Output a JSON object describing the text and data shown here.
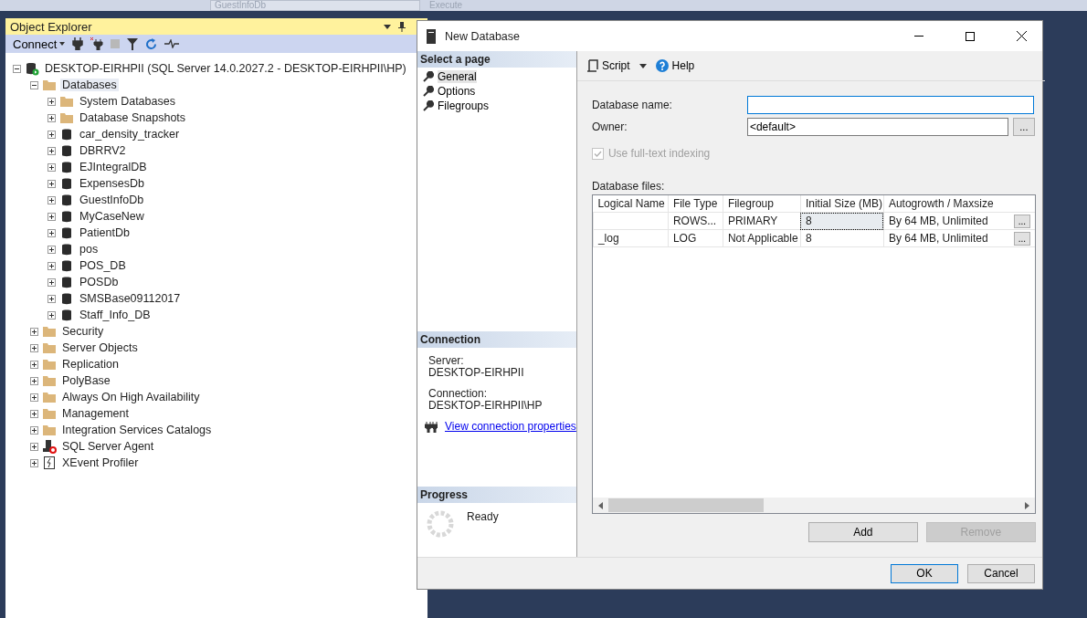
{
  "top_toolbar": {
    "database_combo": "GuestInfoDb",
    "execute": "Execute"
  },
  "object_explorer": {
    "title": "Object Explorer",
    "connect": "Connect",
    "tree": [
      {
        "label": "DESKTOP-EIRHPII (SQL Server 14.0.2027.2 - DESKTOP-EIRHPII\\HP)",
        "kind": "server",
        "expanded": true,
        "selected": false,
        "children": [
          {
            "label": "Databases",
            "kind": "folder",
            "expanded": true,
            "selected": true,
            "children": [
              {
                "label": "System Databases",
                "kind": "folder",
                "expanded": false,
                "selected": false
              },
              {
                "label": "Database Snapshots",
                "kind": "folder",
                "expanded": false,
                "selected": false
              },
              {
                "label": "car_density_tracker",
                "kind": "database",
                "expanded": false,
                "selected": false
              },
              {
                "label": "DBRRV2",
                "kind": "database",
                "expanded": false,
                "selected": false
              },
              {
                "label": "EJIntegralDB",
                "kind": "database",
                "expanded": false,
                "selected": false
              },
              {
                "label": "ExpensesDb",
                "kind": "database",
                "expanded": false,
                "selected": false
              },
              {
                "label": "GuestInfoDb",
                "kind": "database",
                "expanded": false,
                "selected": false
              },
              {
                "label": "MyCaseNew",
                "kind": "database",
                "expanded": false,
                "selected": false
              },
              {
                "label": "PatientDb",
                "kind": "database",
                "expanded": false,
                "selected": false
              },
              {
                "label": "pos",
                "kind": "database",
                "expanded": false,
                "selected": false
              },
              {
                "label": "POS_DB",
                "kind": "database",
                "expanded": false,
                "selected": false
              },
              {
                "label": "POSDb",
                "kind": "database",
                "expanded": false,
                "selected": false
              },
              {
                "label": "SMSBase09112017",
                "kind": "database",
                "expanded": false,
                "selected": false
              },
              {
                "label": "Staff_Info_DB",
                "kind": "database",
                "expanded": false,
                "selected": false
              }
            ]
          },
          {
            "label": "Security",
            "kind": "folder",
            "expanded": false,
            "selected": false
          },
          {
            "label": "Server Objects",
            "kind": "folder",
            "expanded": false,
            "selected": false
          },
          {
            "label": "Replication",
            "kind": "folder",
            "expanded": false,
            "selected": false
          },
          {
            "label": "PolyBase",
            "kind": "folder",
            "expanded": false,
            "selected": false
          },
          {
            "label": "Always On High Availability",
            "kind": "folder",
            "expanded": false,
            "selected": false
          },
          {
            "label": "Management",
            "kind": "folder",
            "expanded": false,
            "selected": false
          },
          {
            "label": "Integration Services Catalogs",
            "kind": "folder",
            "expanded": false,
            "selected": false
          },
          {
            "label": "SQL Server Agent",
            "kind": "agent",
            "expanded": false,
            "selected": false
          },
          {
            "label": "XEvent Profiler",
            "kind": "profiler",
            "expanded": false,
            "selected": false
          }
        ]
      }
    ]
  },
  "dialog": {
    "title": "New Database",
    "select_page": {
      "heading": "Select a page",
      "pages": [
        {
          "label": "General",
          "selected": true
        },
        {
          "label": "Options",
          "selected": false
        },
        {
          "label": "Filegroups",
          "selected": false
        }
      ]
    },
    "connection": {
      "heading": "Connection",
      "server_label": "Server:",
      "server": "DESKTOP-EIRHPII",
      "connection_label": "Connection:",
      "connection": "DESKTOP-EIRHPII\\HP",
      "link": "View connection properties"
    },
    "progress": {
      "heading": "Progress",
      "status": "Ready"
    },
    "toolbar": {
      "script": "Script",
      "help": "Help"
    },
    "database_name": {
      "label": "Database name:"
    },
    "owner": {
      "label": "Owner:",
      "value": "<default>",
      "browse": "..."
    },
    "full_text": {
      "label": "Use full-text indexing",
      "checked": true,
      "disabled": true
    },
    "files": {
      "label": "Database files:",
      "columns": [
        "Logical Name",
        "File Type",
        "Filegroup",
        "Initial Size (MB)",
        "Autogrowth / Maxsize"
      ],
      "rows": [
        {
          "cells": [
            "",
            "ROWS...",
            "PRIMARY",
            "8",
            "By 64 MB, Unlimited"
          ],
          "browse": "..."
        },
        {
          "cells": [
            "_log",
            "LOG",
            "Not Applicable",
            "8",
            "By 64 MB, Unlimited"
          ],
          "browse": "..."
        }
      ]
    },
    "add": {
      "label": "Add",
      "disabled": false
    },
    "remove": {
      "label": "Remove",
      "disabled": true
    },
    "ok": "OK",
    "cancel": "Cancel"
  }
}
